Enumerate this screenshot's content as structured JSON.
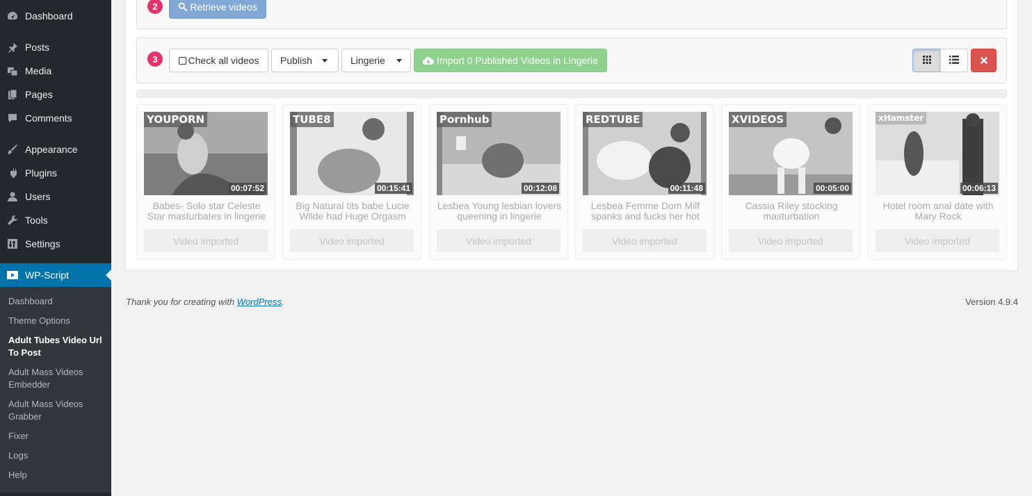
{
  "sidebar": {
    "menu": [
      {
        "label": "Dashboard",
        "icon": "dashboard-icon"
      },
      {
        "label": "Posts",
        "icon": "pin-icon"
      },
      {
        "label": "Media",
        "icon": "media-icon"
      },
      {
        "label": "Pages",
        "icon": "pages-icon"
      },
      {
        "label": "Comments",
        "icon": "comment-icon"
      },
      {
        "label": "Appearance",
        "icon": "brush-icon"
      },
      {
        "label": "Plugins",
        "icon": "plugin-icon"
      },
      {
        "label": "Users",
        "icon": "user-icon"
      },
      {
        "label": "Tools",
        "icon": "wrench-icon"
      },
      {
        "label": "Settings",
        "icon": "settings-icon"
      },
      {
        "label": "WP-Script",
        "icon": "play-icon"
      }
    ],
    "submenu": [
      "Dashboard",
      "Theme Options",
      "Adult Tubes Video Url To Post",
      "Adult Mass Videos Embedder",
      "Adult Mass Videos Grabber",
      "Fixer",
      "Logs",
      "Help"
    ]
  },
  "step2": {
    "number": "2",
    "button": "Retrieve videos"
  },
  "step3": {
    "number": "3",
    "check_all": "Check all videos",
    "status_select": "Publish",
    "category_select": "Lingerie",
    "import_button": "Import 0 Published Videos in Lingerie"
  },
  "videos": [
    {
      "site": "YOUPORN",
      "duration": "00:07:52",
      "title": "Babes- Solo star Celeste Star masturbates in lingerie",
      "status": "Video imported"
    },
    {
      "site": "TUBE8",
      "duration": "00:15:41",
      "title": "Big Natural tits babe Lucie Wilde had Huge Orgasm",
      "status": "Video imported"
    },
    {
      "site": "Pornhub",
      "duration": "00:12:08",
      "title": "Lesbea Young lesbian lovers queening in lingerie",
      "status": "Video imported"
    },
    {
      "site": "REDTUBE",
      "duration": "00:11:48",
      "title": "Lesbea Femme Dom Milf spanks and fucks her hot",
      "status": "Video imported"
    },
    {
      "site": "XVIDEOS",
      "duration": "00:05:00",
      "title": "Cassia Riley stocking masturbation",
      "status": "Video imported"
    },
    {
      "site": "xHamster",
      "duration": "00:06:13",
      "title": "Hotel room anal date with Mary Rock",
      "status": "Video imported"
    }
  ],
  "footer": {
    "thanks_prefix": "Thank you for creating with ",
    "thanks_link": "WordPress",
    "thanks_suffix": ".",
    "version": "Version 4.9.4"
  }
}
